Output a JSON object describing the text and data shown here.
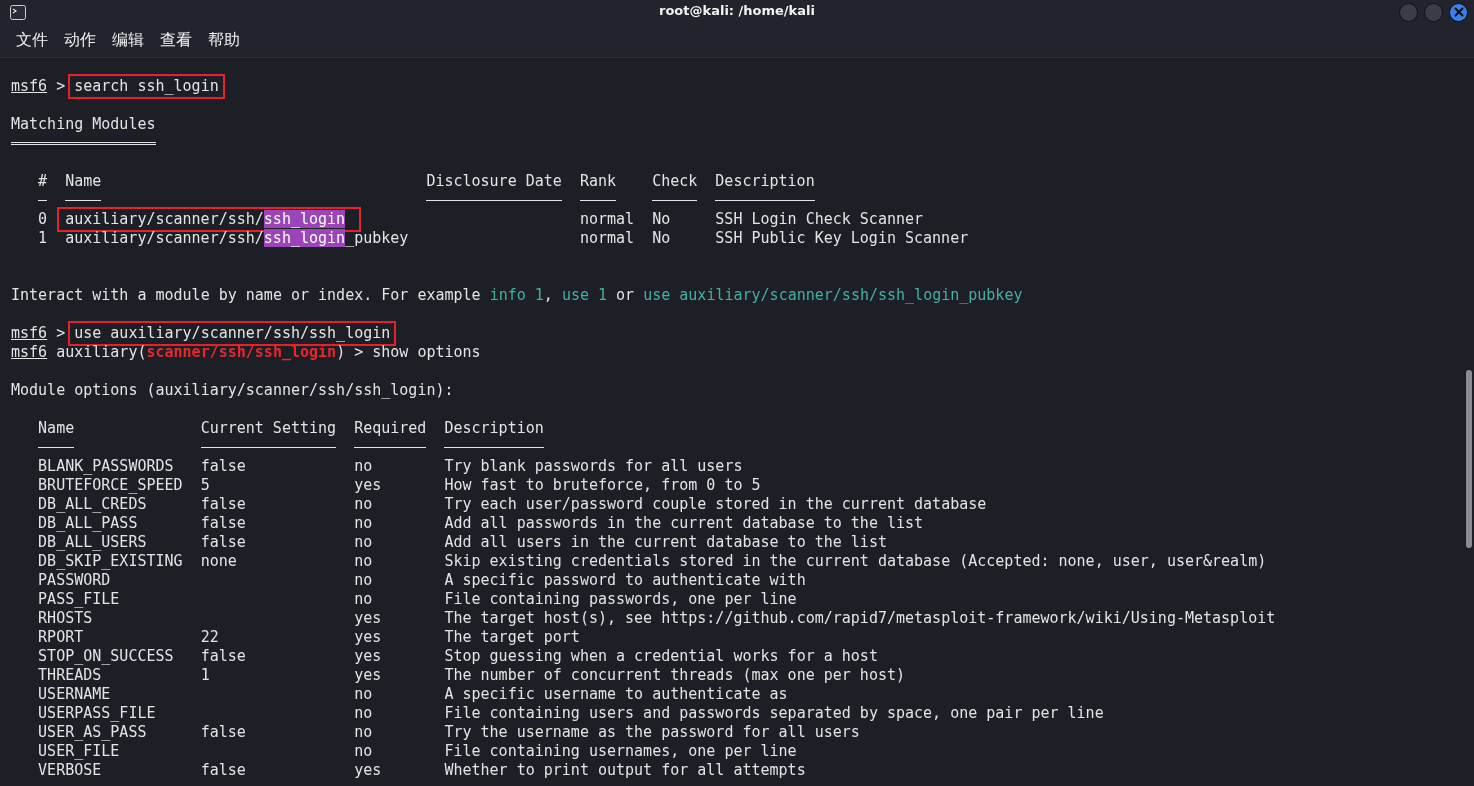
{
  "window": {
    "title": "root@kali: /home/kali"
  },
  "menu": [
    "文件",
    "动作",
    "编辑",
    "查看",
    "帮助"
  ],
  "terminal": [
    {
      "kind": "prompt",
      "segments": [
        {
          "text": "msf6",
          "kind": "user"
        },
        {
          "text": " > ",
          "kind": "plain"
        }
      ],
      "command": "search ssh_login",
      "boxed": true
    },
    {
      "kind": "heading",
      "text": "Matching Modules",
      "underlined": true
    },
    {
      "kind": "module_table",
      "columns": [
        "#",
        "Name",
        "Disclosure Date",
        "Rank",
        "Check",
        "Description"
      ],
      "rows": [
        {
          "index": "0",
          "name": [
            {
              "text": "auxiliary/scanner/ssh/",
              "kind": "plain"
            },
            {
              "text": "ssh_login",
              "kind": "match"
            }
          ],
          "rank": "normal",
          "check": "No",
          "description": "SSH Login Check Scanner",
          "boxed": true
        },
        {
          "index": "1",
          "name": [
            {
              "text": "auxiliary/scanner/ssh/",
              "kind": "plain"
            },
            {
              "text": "ssh_login",
              "kind": "match"
            },
            {
              "text": "_pubkey",
              "kind": "plain"
            }
          ],
          "rank": "normal",
          "check": "No",
          "description": "SSH Public Key Login Scanner",
          "boxed": false
        }
      ]
    },
    {
      "kind": "hint",
      "segments": [
        {
          "text": "Interact with a module by name or index. For example ",
          "kind": "plain"
        },
        {
          "text": "info 1",
          "kind": "example"
        },
        {
          "text": ", ",
          "kind": "plain"
        },
        {
          "text": "use 1",
          "kind": "example"
        },
        {
          "text": " or ",
          "kind": "plain"
        },
        {
          "text": "use auxiliary/scanner/ssh/ssh_login_pubkey",
          "kind": "example"
        }
      ]
    },
    {
      "kind": "prompt",
      "segments": [
        {
          "text": "msf6",
          "kind": "user"
        },
        {
          "text": " > ",
          "kind": "plain"
        }
      ],
      "command": "use auxiliary/scanner/ssh/ssh_login",
      "boxed": true
    },
    {
      "kind": "prompt",
      "segments": [
        {
          "text": "msf6",
          "kind": "user"
        },
        {
          "text": " auxiliary(",
          "kind": "plain"
        },
        {
          "text": "scanner/ssh/ssh_login",
          "kind": "module"
        },
        {
          "text": ") > ",
          "kind": "plain"
        }
      ],
      "command": "show options",
      "boxed": false
    },
    {
      "kind": "heading",
      "text": "Module options (auxiliary/scanner/ssh/ssh_login):",
      "underlined": false
    },
    {
      "kind": "options_table",
      "columns": [
        "Name",
        "Current Setting",
        "Required",
        "Description"
      ],
      "rows": [
        {
          "name": "BLANK_PASSWORDS",
          "setting": "false",
          "required": "no",
          "description": "Try blank passwords for all users"
        },
        {
          "name": "BRUTEFORCE_SPEED",
          "setting": "5",
          "required": "yes",
          "description": "How fast to bruteforce, from 0 to 5"
        },
        {
          "name": "DB_ALL_CREDS",
          "setting": "false",
          "required": "no",
          "description": "Try each user/password couple stored in the current database"
        },
        {
          "name": "DB_ALL_PASS",
          "setting": "false",
          "required": "no",
          "description": "Add all passwords in the current database to the list"
        },
        {
          "name": "DB_ALL_USERS",
          "setting": "false",
          "required": "no",
          "description": "Add all users in the current database to the list"
        },
        {
          "name": "DB_SKIP_EXISTING",
          "setting": "none",
          "required": "no",
          "description": "Skip existing credentials stored in the current database (Accepted: none, user, user&realm)"
        },
        {
          "name": "PASSWORD",
          "required": "no",
          "description": "A specific password to authenticate with"
        },
        {
          "name": "PASS_FILE",
          "required": "no",
          "description": "File containing passwords, one per line"
        },
        {
          "name": "RHOSTS",
          "required": "yes",
          "description": "The target host(s), see https://github.com/rapid7/metasploit-framework/wiki/Using-Metasploit"
        },
        {
          "name": "RPORT",
          "setting": "22",
          "required": "yes",
          "description": "The target port"
        },
        {
          "name": "STOP_ON_SUCCESS",
          "setting": "false",
          "required": "yes",
          "description": "Stop guessing when a credential works for a host"
        },
        {
          "name": "THREADS",
          "setting": "1",
          "required": "yes",
          "description": "The number of concurrent threads (max one per host)"
        },
        {
          "name": "USERNAME",
          "required": "no",
          "description": "A specific username to authenticate as"
        },
        {
          "name": "USERPASS_FILE",
          "required": "no",
          "description": "File containing users and passwords separated by space, one pair per line"
        },
        {
          "name": "USER_AS_PASS",
          "setting": "false",
          "required": "no",
          "description": "Try the username as the password for all users"
        },
        {
          "name": "USER_FILE",
          "required": "no",
          "description": "File containing usernames, one per line"
        },
        {
          "name": "VERBOSE",
          "setting": "false",
          "required": "yes",
          "description": "Whether to print output for all attempts"
        }
      ]
    }
  ]
}
